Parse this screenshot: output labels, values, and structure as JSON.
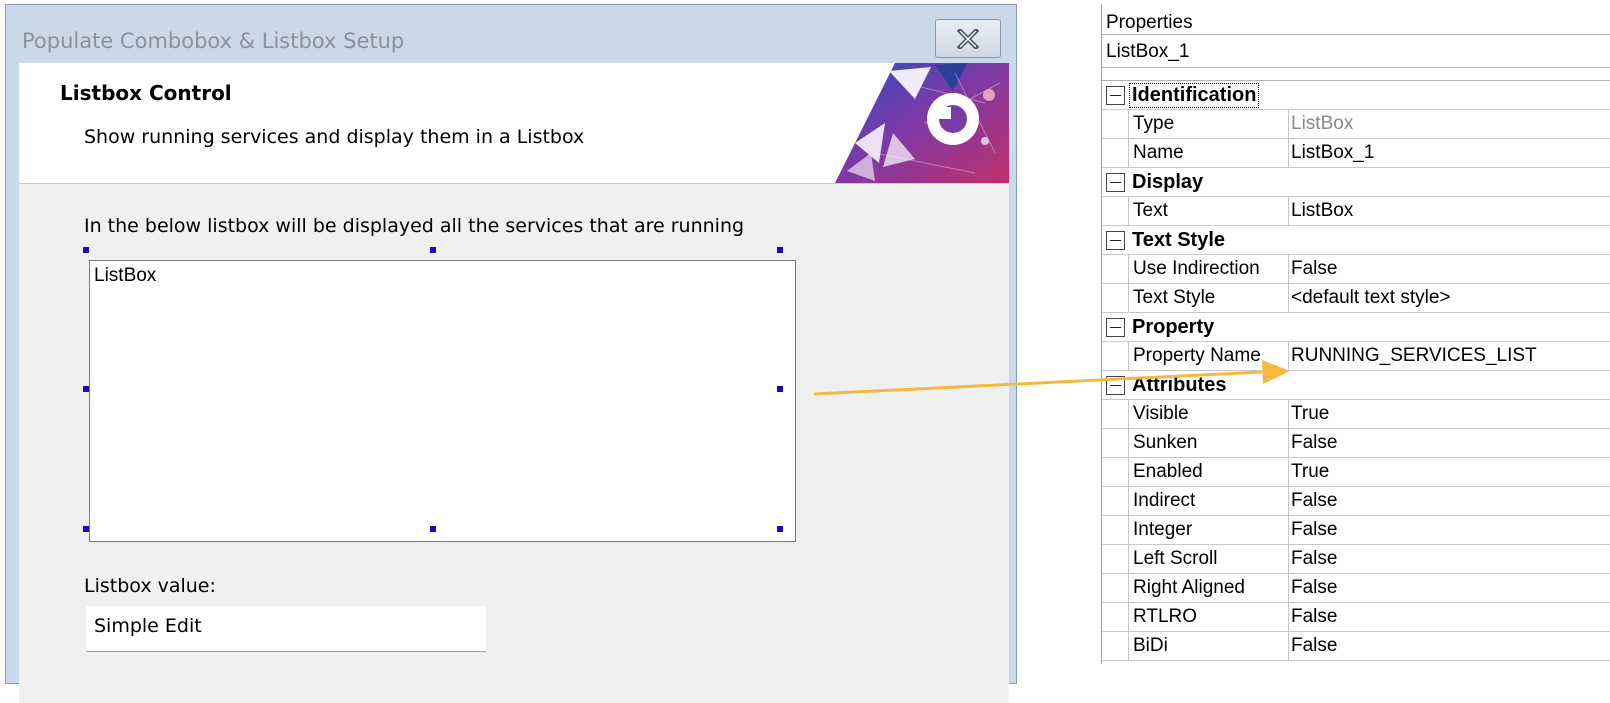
{
  "dialog": {
    "title": "Populate Combobox & Listbox Setup",
    "banner_title": "Listbox Control",
    "banner_subtitle": "Show running services and display them in a Listbox",
    "intro_text": "In the below listbox will be displayed all the services that are running",
    "listbox_text": "ListBox",
    "listbox_value_label": "Listbox value:",
    "simple_edit_text": "Simple Edit"
  },
  "properties": {
    "header": "Properties",
    "object_name": "ListBox_1",
    "categories": [
      {
        "label": "Identification",
        "rows": [
          {
            "name": "Type",
            "value": "ListBox"
          },
          {
            "name": "Name",
            "value": "ListBox_1"
          }
        ]
      },
      {
        "label": "Display",
        "rows": [
          {
            "name": "Text",
            "value": "ListBox"
          }
        ]
      },
      {
        "label": "Text Style",
        "rows": [
          {
            "name": "Use Indirection",
            "value": "False"
          },
          {
            "name": "Text Style",
            "value": "<default text style>"
          }
        ]
      },
      {
        "label": "Property",
        "rows": [
          {
            "name": "Property Name",
            "value": "RUNNING_SERVICES_LIST"
          }
        ]
      },
      {
        "label": "Attributes",
        "rows": [
          {
            "name": "Visible",
            "value": "True"
          },
          {
            "name": "Sunken",
            "value": "False"
          },
          {
            "name": "Enabled",
            "value": "True"
          },
          {
            "name": "Indirect",
            "value": "False"
          },
          {
            "name": "Integer",
            "value": "False"
          },
          {
            "name": "Left Scroll",
            "value": "False"
          },
          {
            "name": "Right Aligned",
            "value": "False"
          },
          {
            "name": "RTLRO",
            "value": "False"
          },
          {
            "name": "BiDi",
            "value": "False"
          }
        ]
      }
    ]
  },
  "colors": {
    "arrow": "#f5b942",
    "selection_handle": "#2400cc",
    "title_bar": "#c9d9ea"
  }
}
